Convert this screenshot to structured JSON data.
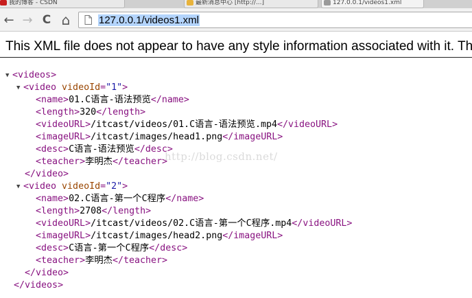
{
  "tabs": [
    {
      "label": "我的博客 - CSDN",
      "fav_color": "#c81e1e"
    },
    {
      "label": "最新消息中心 [http://...]",
      "fav_color": "#e8b33b"
    },
    {
      "label": "127.0.0.1/videos1.xml",
      "fav_color": "#9a9a9a"
    }
  ],
  "toolbar": {
    "back_icon": "←",
    "forward_icon": "→",
    "reload_icon": "C",
    "home_icon": "⌂",
    "url": "127.0.0.1/videos1.xml"
  },
  "info_text": "This XML file does not appear to have any style information associated with it. The document tree is shown below.",
  "watermark": "http://blog.csdn.net/",
  "xml": {
    "root_tag": "videos",
    "videos": [
      {
        "attr_name": "videoId",
        "attr_value": "1",
        "fields": [
          {
            "tag": "name",
            "text": "01.C语言-语法预览"
          },
          {
            "tag": "length",
            "text": "320"
          },
          {
            "tag": "videoURL",
            "text": "/itcast/videos/01.C语言-语法预览.mp4"
          },
          {
            "tag": "imageURL",
            "text": "/itcast/images/head1.png"
          },
          {
            "tag": "desc",
            "text": "C语言-语法预览"
          },
          {
            "tag": "teacher",
            "text": "李明杰"
          }
        ]
      },
      {
        "attr_name": "videoId",
        "attr_value": "2",
        "fields": [
          {
            "tag": "name",
            "text": "02.C语言-第一个C程序"
          },
          {
            "tag": "length",
            "text": "2708"
          },
          {
            "tag": "videoURL",
            "text": "/itcast/videos/02.C语言-第一个C程序.mp4"
          },
          {
            "tag": "imageURL",
            "text": "/itcast/images/head2.png"
          },
          {
            "tag": "desc",
            "text": "C语言-第一个C程序"
          },
          {
            "tag": "teacher",
            "text": "李明杰"
          }
        ]
      }
    ]
  }
}
